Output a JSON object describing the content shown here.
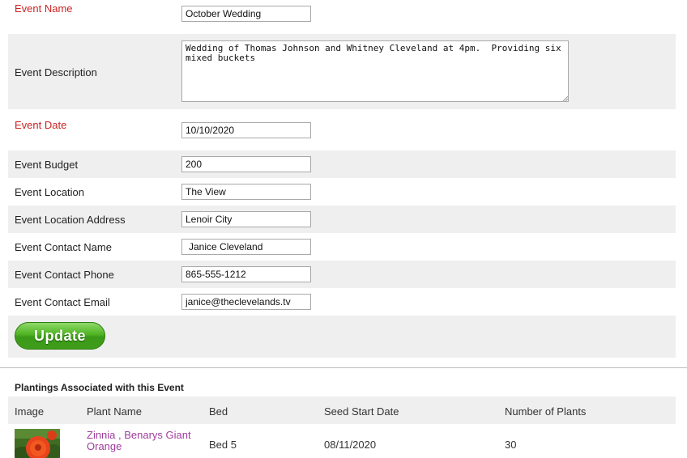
{
  "form": {
    "event_name": {
      "label": "Event Name",
      "value": "October Wedding"
    },
    "event_description": {
      "label": "Event Description",
      "value": "Wedding of Thomas Johnson and Whitney Cleveland at 4pm.  Providing six mixed buckets"
    },
    "event_date": {
      "label": "Event Date",
      "value": "10/10/2020"
    },
    "event_budget": {
      "label": "Event Budget",
      "value": "200"
    },
    "event_location": {
      "label": "Event Location",
      "value": "The View"
    },
    "event_location_address": {
      "label": "Event Location Address",
      "value": "Lenoir City"
    },
    "event_contact_name": {
      "label": "Event Contact Name",
      "value": "Janice Cleveland"
    },
    "event_contact_phone": {
      "label": "Event Contact Phone",
      "value": "865-555-1212"
    },
    "event_contact_email": {
      "label": "Event Contact Email",
      "value": "janice@theclevelands.tv"
    },
    "update_label": "Update"
  },
  "plantings": {
    "title": "Plantings Associated with this Event",
    "headers": [
      "Image",
      "Plant Name",
      "Bed",
      "Seed Start Date",
      "Number of Plants"
    ],
    "rows": [
      {
        "plant_name": "Zinnia , Benarys Giant Orange",
        "bed": "Bed 5",
        "seed_start_date": "08/11/2020",
        "number_of_plants": "30"
      }
    ]
  },
  "colors": {
    "required_label": "#cc2222",
    "row_shade": "#efefef",
    "button_green": "#4fb322",
    "plant_link": "#a03c9e"
  }
}
